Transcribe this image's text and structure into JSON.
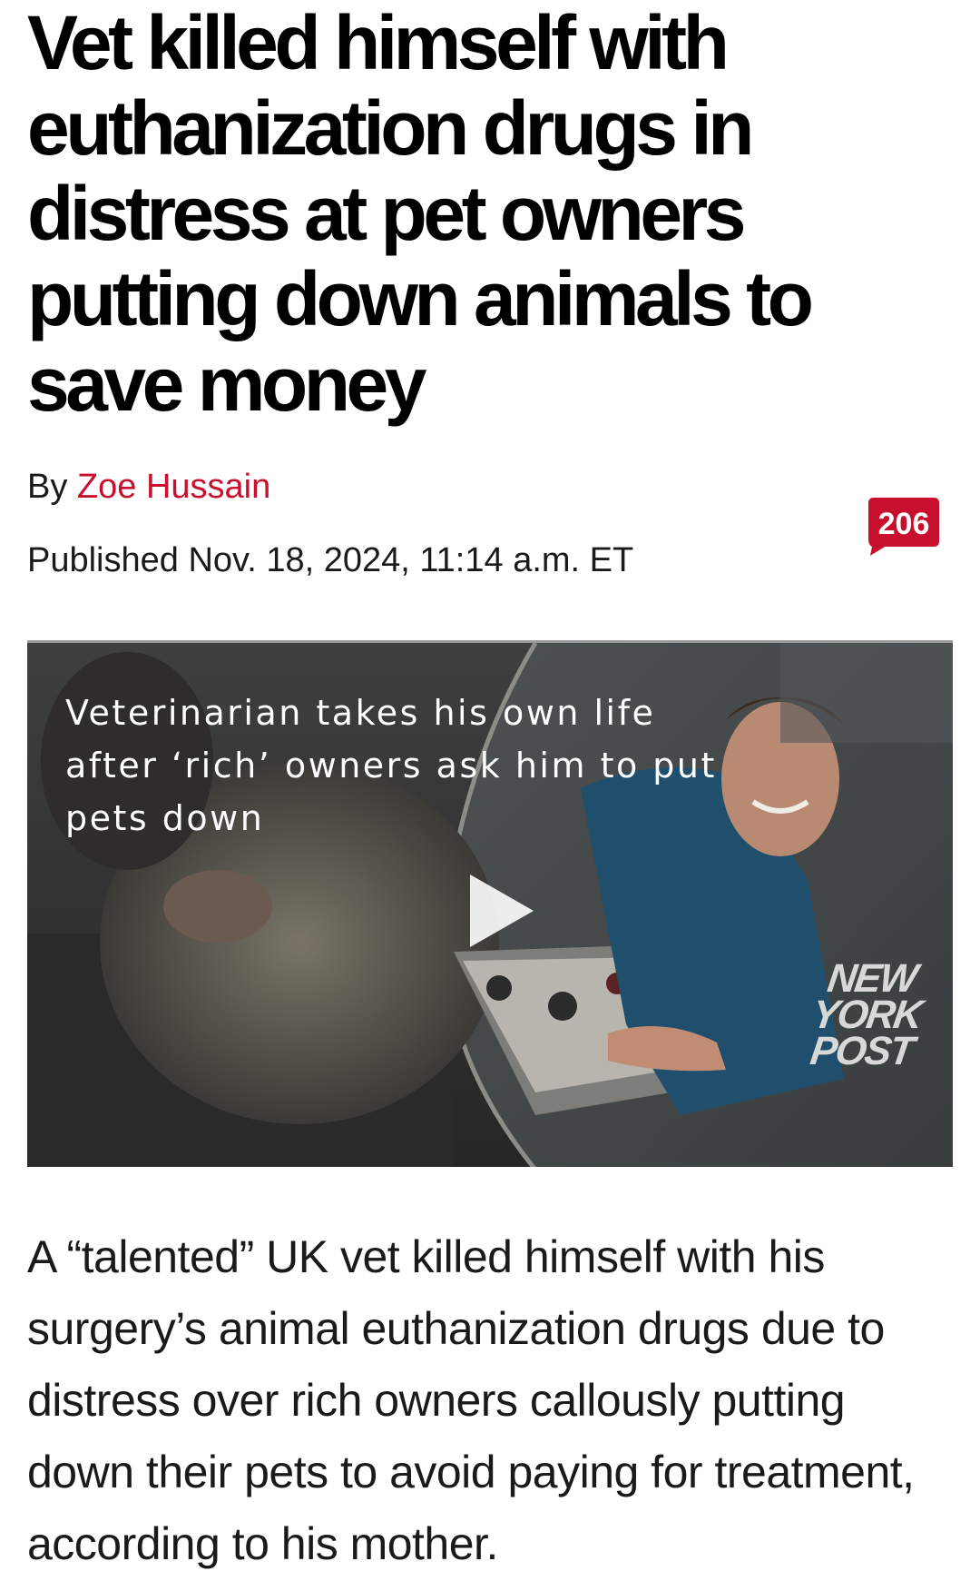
{
  "article": {
    "headline": "Vet killed himself with euthanization drugs in distress at pet owners putting down animals to save money",
    "byline_prefix": "By ",
    "author": "Zoe Hussain",
    "published": "Published Nov. 18, 2024, 11:14 a.m. ET",
    "comment_count": "206",
    "body": "A “talented” UK vet killed himself with his surgery’s animal euthanization drugs due to distress over rich owners callously putting down their pets to avoid paying for treatment, according to his mother."
  },
  "video": {
    "title": "Veterinarian takes his own life after ‘rich’ owners ask him to put pets down",
    "watermark_lines": [
      "NEW",
      "YORK",
      "POST"
    ]
  },
  "colors": {
    "author_link": "#c8102e",
    "comment_badge": "#c8102e",
    "headline": "#000000"
  },
  "icons": {
    "comment": "speech-bubble-icon",
    "play": "play-icon"
  }
}
